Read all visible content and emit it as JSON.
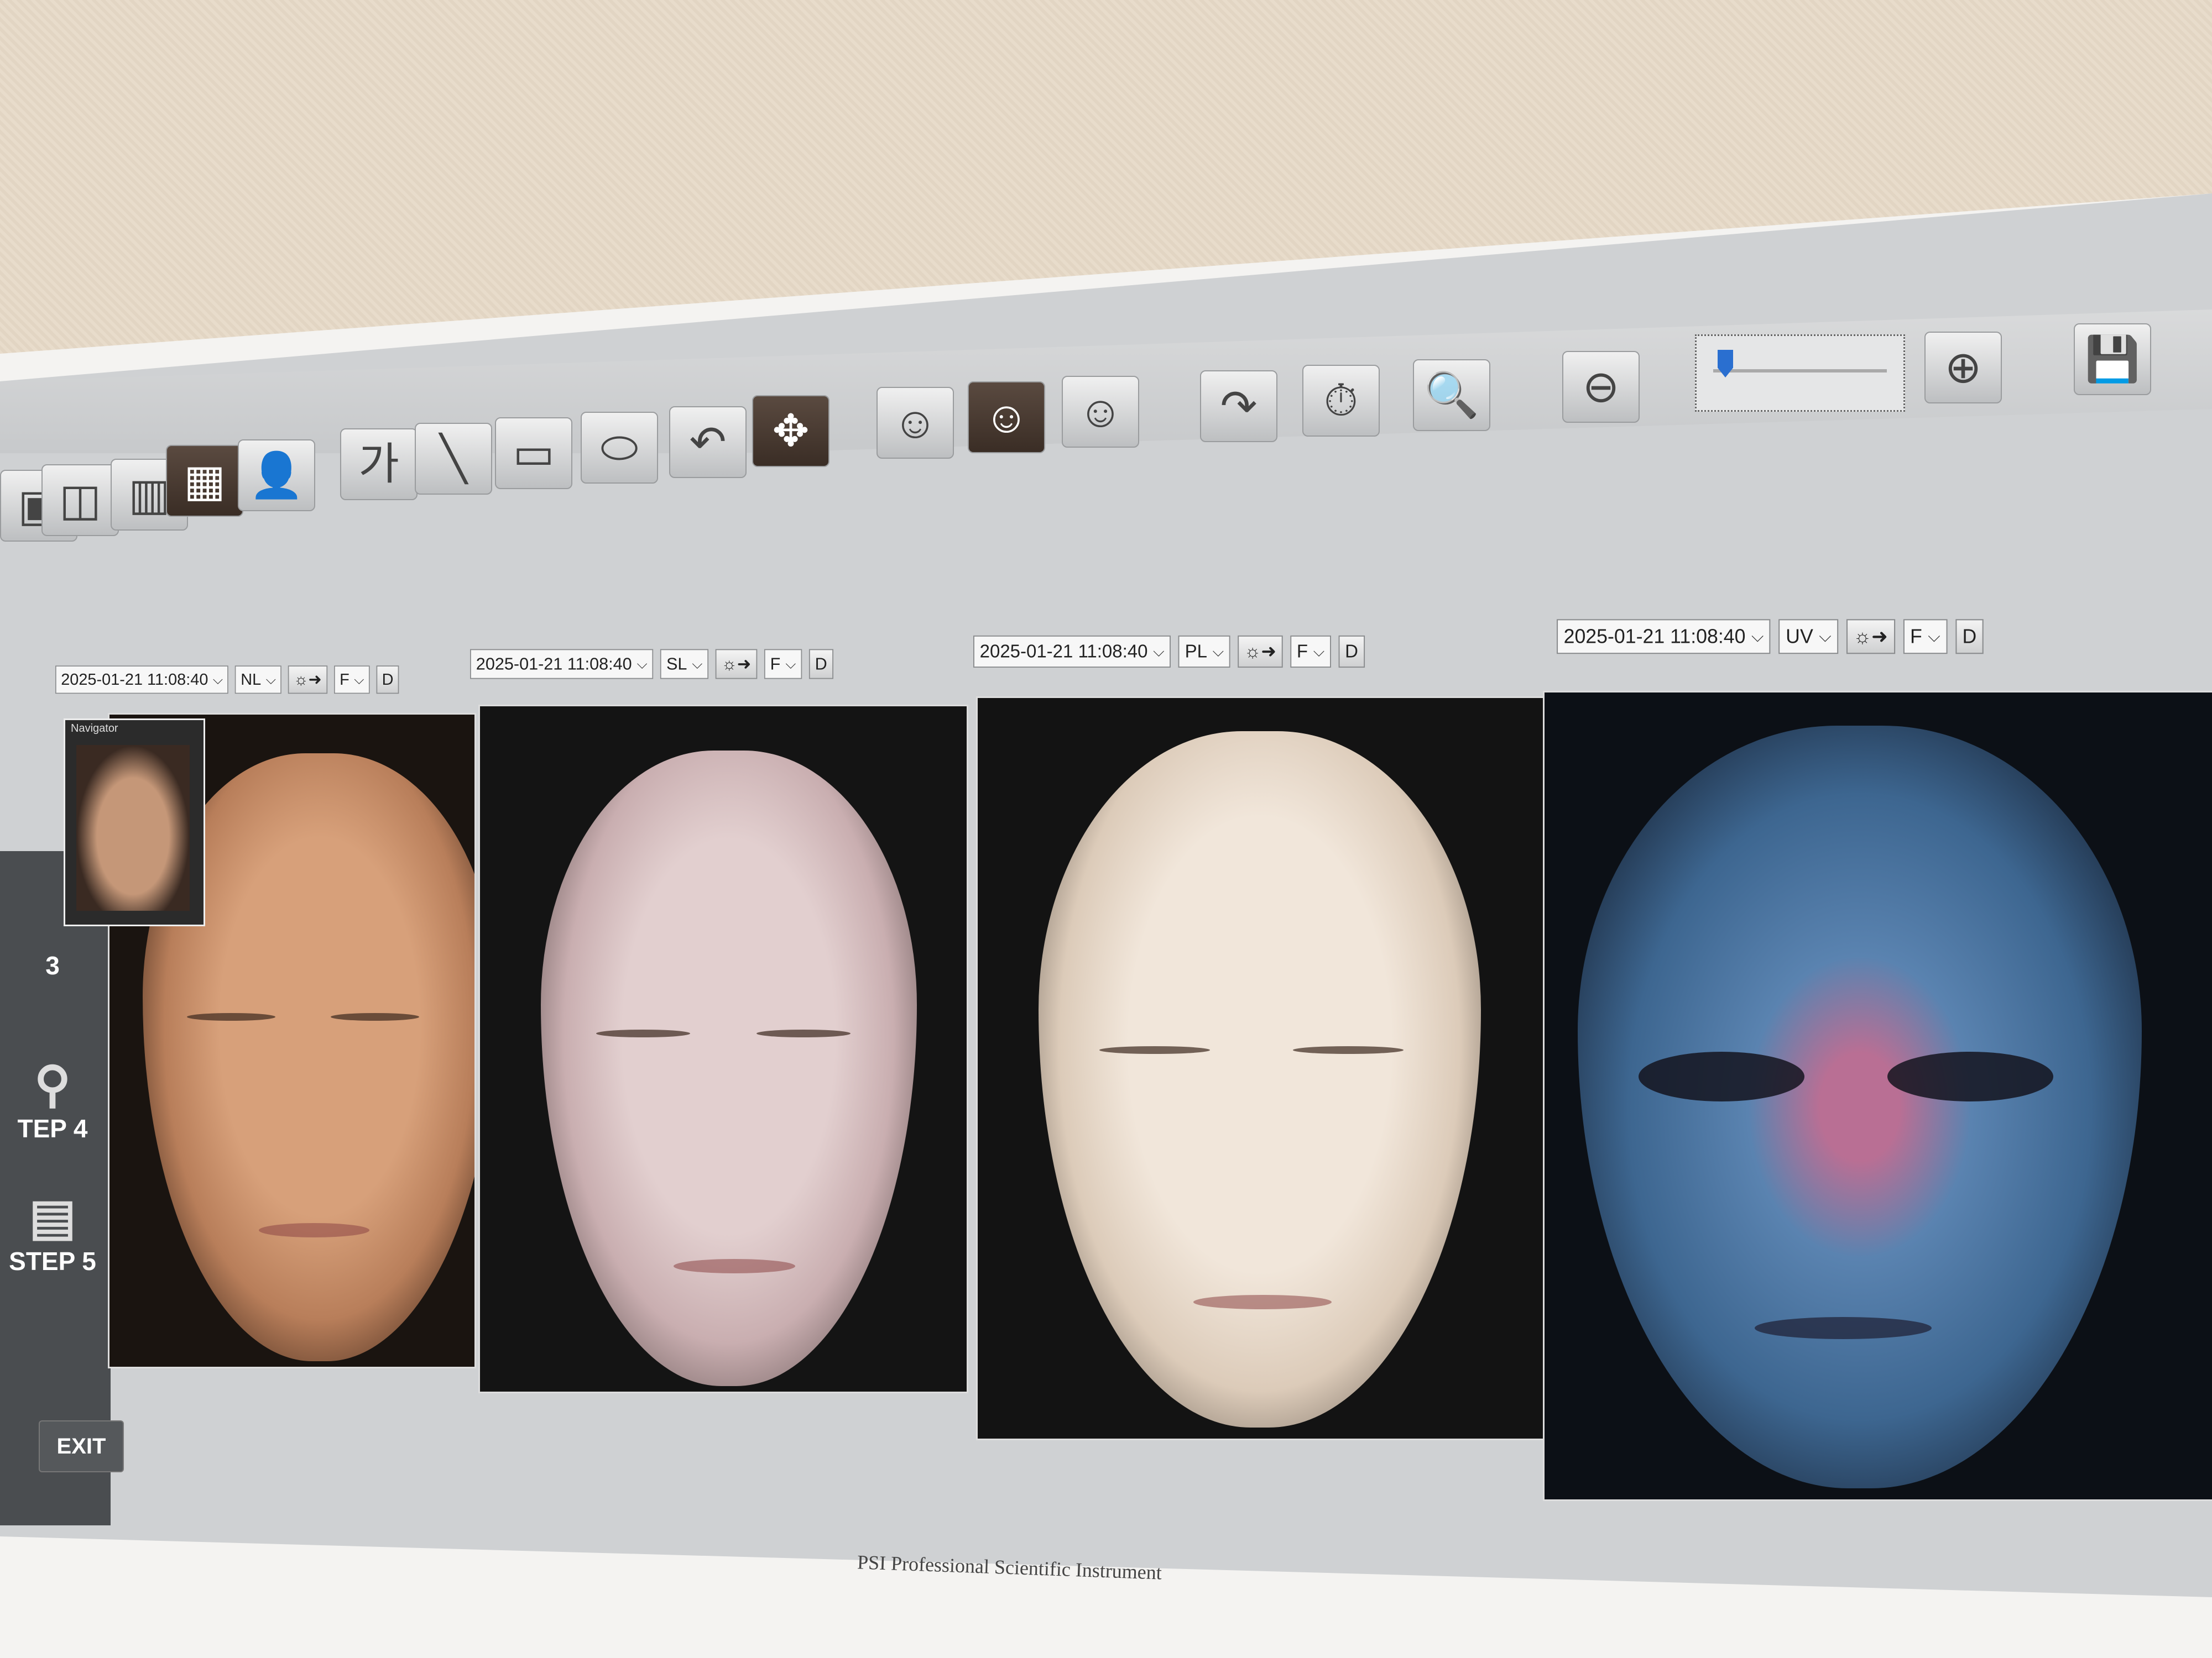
{
  "toolbar": {
    "buttons": [
      {
        "name": "single-view-icon",
        "glyph": "▣"
      },
      {
        "name": "dual-view-icon",
        "glyph": "◫"
      },
      {
        "name": "triple-view-icon",
        "glyph": "▥"
      },
      {
        "name": "quad-view-icon",
        "glyph": "▦"
      },
      {
        "name": "patient-icon",
        "glyph": "👤"
      },
      {
        "name": "text-annotation-icon",
        "glyph": "가"
      },
      {
        "name": "line-tool-icon",
        "glyph": "╲"
      },
      {
        "name": "rectangle-tool-icon",
        "glyph": "▭"
      },
      {
        "name": "ellipse-tool-icon",
        "glyph": "⬭"
      },
      {
        "name": "undo-icon",
        "glyph": "↶"
      },
      {
        "name": "move-icon",
        "glyph": "✥"
      },
      {
        "name": "face-left-icon",
        "glyph": "☺"
      },
      {
        "name": "face-front-icon",
        "glyph": "☺"
      },
      {
        "name": "face-right-icon",
        "glyph": "☺"
      },
      {
        "name": "redo-icon",
        "glyph": "↷"
      },
      {
        "name": "timer-icon",
        "glyph": "⏱"
      },
      {
        "name": "patient-search-icon",
        "glyph": "🔍"
      },
      {
        "name": "zoom-out-icon",
        "glyph": "⊖"
      },
      {
        "name": "zoom-in-icon",
        "glyph": "⊕"
      },
      {
        "name": "save-icon",
        "glyph": "💾"
      }
    ],
    "zoom_level": 0.05
  },
  "sidebar": {
    "steps": [
      {
        "label": "3",
        "icon": ""
      },
      {
        "label": "TEP 4",
        "icon": "magnifier-icon"
      },
      {
        "label": "STEP 5",
        "icon": "compare-icon"
      }
    ],
    "exit_label": "EXIT"
  },
  "navigator": {
    "title": "Navigator"
  },
  "panels": [
    {
      "timestamp": "2025-01-21 11:08:40",
      "mode": "NL",
      "light": "☼➜",
      "view": "F",
      "d": "D",
      "tone": "natural"
    },
    {
      "timestamp": "2025-01-21 11:08:40",
      "mode": "SL",
      "light": "☼➜",
      "view": "F",
      "d": "D",
      "tone": "standard"
    },
    {
      "timestamp": "2025-01-21 11:08:40",
      "mode": "PL",
      "light": "☼➜",
      "view": "F",
      "d": "D",
      "tone": "polarized"
    },
    {
      "timestamp": "2025-01-21 11:08:40",
      "mode": "UV",
      "light": "☼➜",
      "view": "F",
      "d": "D",
      "tone": "ultraviolet"
    }
  ],
  "footer": {
    "brand": "PSI Professional Scientific Instrument"
  }
}
